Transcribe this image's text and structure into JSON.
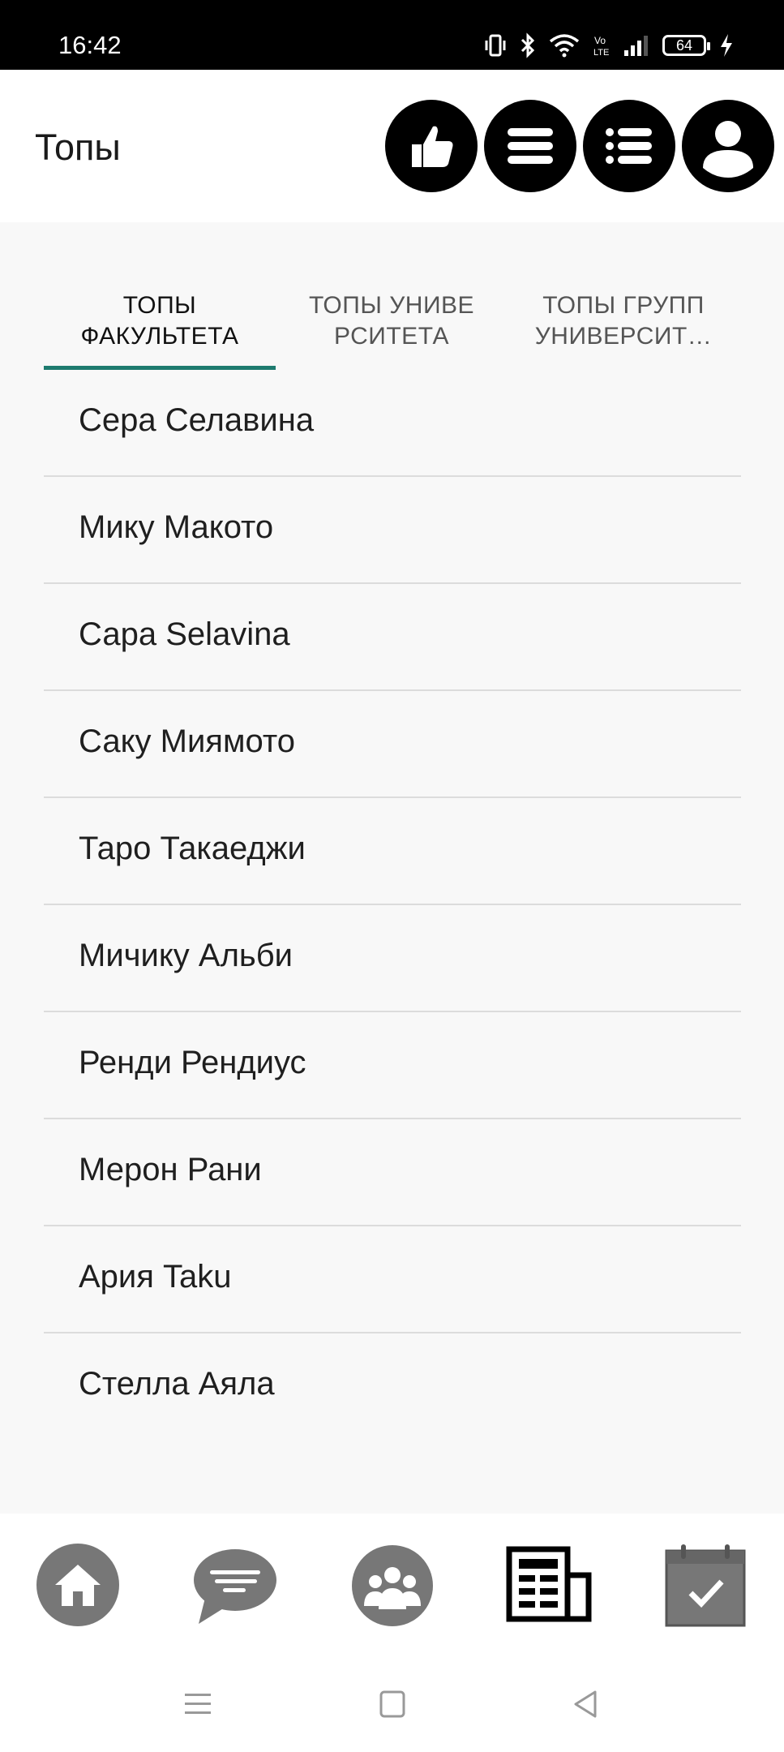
{
  "status_bar": {
    "time": "16:42",
    "battery": "64"
  },
  "header": {
    "title": "Топы",
    "buttons": [
      "thumbs-up-icon",
      "menu-icon",
      "list-icon",
      "profile-icon"
    ]
  },
  "tabs": [
    {
      "label": "ТОПЫ ФАКУЛЬТЕТА",
      "active": true
    },
    {
      "label": "ТОПЫ УНИВЕ РСИТЕТА",
      "active": false
    },
    {
      "label": "ТОПЫ ГРУПП УНИВЕРСИТ…",
      "active": false
    }
  ],
  "tab_lines": [
    [
      "ТОПЫ",
      "ФАКУЛЬТЕТА"
    ],
    [
      "ТОПЫ УНИВЕ",
      "РСИТЕТА"
    ],
    [
      "ТОПЫ ГРУПП",
      "УНИВЕРСИТ…"
    ]
  ],
  "list": [
    "Сера Селавина",
    "Мику Макото",
    "Сара Selavina",
    "Саку Миямото",
    "Таро Такаеджи",
    "Мичику Альби",
    "Ренди Рендиус",
    "Мерон Рани",
    "Ария Taku",
    "Стелла Аяла"
  ],
  "bottom_nav": [
    "home-icon",
    "chat-icon",
    "groups-icon",
    "news-icon",
    "calendar-check-icon"
  ],
  "system_nav": [
    "recents-icon",
    "home-square-icon",
    "back-icon"
  ],
  "colors": {
    "accent": "#1e7b6f",
    "nav_gray": "#777777"
  }
}
